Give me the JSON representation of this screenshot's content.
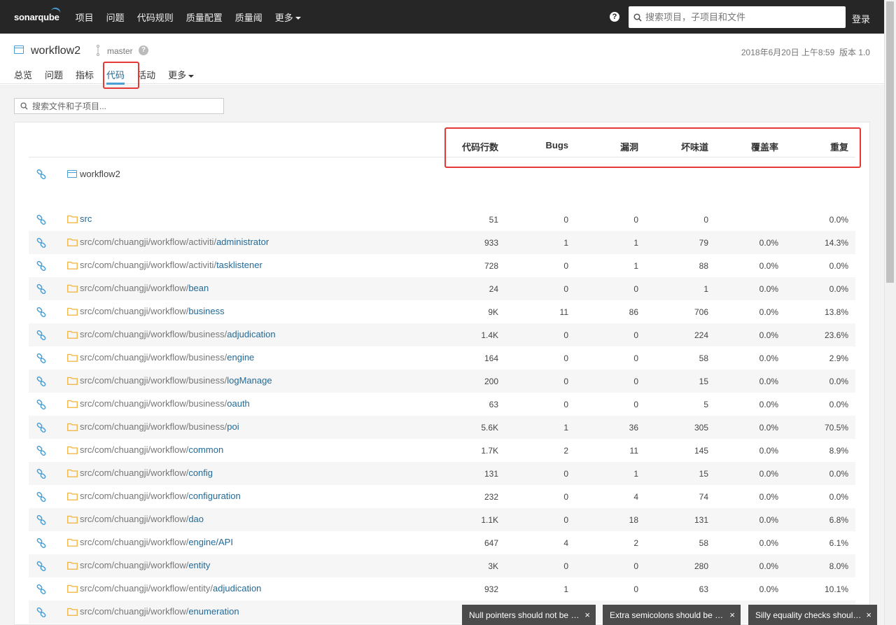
{
  "topnav": {
    "logo": "sonarqube",
    "items": [
      {
        "label": "项目"
      },
      {
        "label": "问题"
      },
      {
        "label": "代码规则"
      },
      {
        "label": "质量配置"
      },
      {
        "label": "质量阈"
      },
      {
        "label": "更多"
      }
    ],
    "search_placeholder": "搜索项目，子项目和文件",
    "login": "登录",
    "help_glyph": "?"
  },
  "project": {
    "name": "workflow2",
    "branch": "master",
    "branch_help": "?",
    "date": "2018年6月20日 上午8:59",
    "version": "版本 1.0",
    "tabs": [
      {
        "label": "总览"
      },
      {
        "label": "问题"
      },
      {
        "label": "指标"
      },
      {
        "label": "代码",
        "active": true
      },
      {
        "label": "活动"
      },
      {
        "label": "更多"
      }
    ]
  },
  "file_search_placeholder": "搜索文件和子项目...",
  "table": {
    "headers": [
      "代码行数",
      "Bugs",
      "漏洞",
      "坏味道",
      "覆盖率",
      "重复"
    ],
    "root_name": "workflow2",
    "rows": [
      {
        "pre": "",
        "last": "src",
        "loc": "51",
        "bugs": "0",
        "vuln": "0",
        "smells": "0",
        "cov": "",
        "dup": "0.0%"
      },
      {
        "pre": "src/com/chuangji/workflow/activiti/",
        "last": "administrator",
        "loc": "933",
        "bugs": "1",
        "vuln": "1",
        "smells": "79",
        "cov": "0.0%",
        "dup": "14.3%"
      },
      {
        "pre": "src/com/chuangji/workflow/activiti/",
        "last": "tasklistener",
        "loc": "728",
        "bugs": "0",
        "vuln": "1",
        "smells": "88",
        "cov": "0.0%",
        "dup": "0.0%"
      },
      {
        "pre": "src/com/chuangji/workflow/",
        "last": "bean",
        "loc": "24",
        "bugs": "0",
        "vuln": "0",
        "smells": "1",
        "cov": "0.0%",
        "dup": "0.0%"
      },
      {
        "pre": "src/com/chuangji/workflow/",
        "last": "business",
        "loc": "9K",
        "bugs": "11",
        "vuln": "86",
        "smells": "706",
        "cov": "0.0%",
        "dup": "13.8%"
      },
      {
        "pre": "src/com/chuangji/workflow/business/",
        "last": "adjudication",
        "loc": "1.4K",
        "bugs": "0",
        "vuln": "0",
        "smells": "224",
        "cov": "0.0%",
        "dup": "23.6%"
      },
      {
        "pre": "src/com/chuangji/workflow/business/",
        "last": "engine",
        "loc": "164",
        "bugs": "0",
        "vuln": "0",
        "smells": "58",
        "cov": "0.0%",
        "dup": "2.9%"
      },
      {
        "pre": "src/com/chuangji/workflow/business/",
        "last": "logManage",
        "loc": "200",
        "bugs": "0",
        "vuln": "0",
        "smells": "15",
        "cov": "0.0%",
        "dup": "0.0%"
      },
      {
        "pre": "src/com/chuangji/workflow/business/",
        "last": "oauth",
        "loc": "63",
        "bugs": "0",
        "vuln": "0",
        "smells": "5",
        "cov": "0.0%",
        "dup": "0.0%"
      },
      {
        "pre": "src/com/chuangji/workflow/business/",
        "last": "poi",
        "loc": "5.6K",
        "bugs": "1",
        "vuln": "36",
        "smells": "305",
        "cov": "0.0%",
        "dup": "70.5%"
      },
      {
        "pre": "src/com/chuangji/workflow/",
        "last": "common",
        "loc": "1.7K",
        "bugs": "2",
        "vuln": "11",
        "smells": "145",
        "cov": "0.0%",
        "dup": "8.9%"
      },
      {
        "pre": "src/com/chuangji/workflow/",
        "last": "config",
        "loc": "131",
        "bugs": "0",
        "vuln": "1",
        "smells": "15",
        "cov": "0.0%",
        "dup": "0.0%"
      },
      {
        "pre": "src/com/chuangji/workflow/",
        "last": "configuration",
        "loc": "232",
        "bugs": "0",
        "vuln": "4",
        "smells": "74",
        "cov": "0.0%",
        "dup": "0.0%"
      },
      {
        "pre": "src/com/chuangji/workflow/",
        "last": "dao",
        "loc": "1.1K",
        "bugs": "0",
        "vuln": "18",
        "smells": "131",
        "cov": "0.0%",
        "dup": "6.8%"
      },
      {
        "pre": "src/com/chuangji/workflow/",
        "last": "engine/API",
        "loc": "647",
        "bugs": "4",
        "vuln": "2",
        "smells": "58",
        "cov": "0.0%",
        "dup": "6.1%"
      },
      {
        "pre": "src/com/chuangji/workflow/",
        "last": "entity",
        "loc": "3K",
        "bugs": "0",
        "vuln": "0",
        "smells": "280",
        "cov": "0.0%",
        "dup": "8.0%"
      },
      {
        "pre": "src/com/chuangji/workflow/entity/",
        "last": "adjudication",
        "loc": "932",
        "bugs": "1",
        "vuln": "0",
        "smells": "63",
        "cov": "0.0%",
        "dup": "10.1%"
      },
      {
        "pre": "src/com/chuangji/workflow/",
        "last": "enumeration",
        "loc": "",
        "bugs": "",
        "vuln": "",
        "smells": "",
        "cov": "",
        "dup": ""
      }
    ]
  },
  "toasts": [
    {
      "text": "Null pointers should not be de..."
    },
    {
      "text": "Extra semicolons should be rem..."
    },
    {
      "text": "Silly equality checks should n..."
    }
  ],
  "toast_close": "×",
  "colors": {
    "nav_bg": "#262626",
    "link": "#236a97",
    "accent": "#4b9fd5",
    "highlight": "#e53935",
    "folder": "#f0b23b"
  }
}
